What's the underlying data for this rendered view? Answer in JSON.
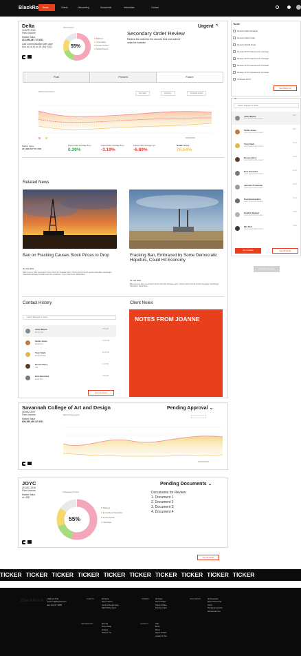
{
  "nav": {
    "logo": "BlackRock",
    "links": [
      "Home",
      "Clients",
      "Onboarding",
      "Documents",
      "Information",
      "Contact"
    ]
  },
  "delta": {
    "name": "Delta",
    "date": "12 APR 2018",
    "type": "Fixed Income",
    "market_label": "Market Value",
    "market_value": "213,998,467.72 USD",
    "last_comm": "Last Communication with Jane Doe at 14:18 on 15 JAN 2020",
    "donut_label": "55%",
    "donut_caption": "Risk Analysis",
    "legend": [
      "Balanced",
      "Conservative",
      "Growth Oriented",
      "Capital Preserve"
    ],
    "urgent": "Urgent",
    "review_title": "Secondary Order Review",
    "review_text": "Review the order for the second time and submit order for transfer",
    "tabs": [
      "Past",
      "Present",
      "Future"
    ],
    "chart_title": "Market Performance",
    "chart_filters": [
      "Sort data",
      "Currency",
      "Forecast period"
    ],
    "chart_legend": [
      "Holdings",
      "Forecast"
    ],
    "metrics": {
      "mv_label": "Market Value",
      "mv_value": "213,998,467.72 USD",
      "m1_label": "Future NAV Change 6mo",
      "m1_value": "0.39%",
      "m2_label": "Future NAV Change 6mo",
      "m2_value": "-3.19%",
      "m3_label": "Future NAV Change 1yr",
      "m3_value": "-6.89%",
      "m4_label": "Health Score",
      "m4_value": "76.54%"
    }
  },
  "news": {
    "title": "Related News",
    "items": [
      {
        "title": "Ban on Fracking Causes Stock Prices to Drop",
        "date": "30 JAN 2020",
        "body": "Bacon ipsum dolor amet beef t-bone short loin brisaola cupim, chuck ground round venison shoulder. Hamburger frankfurter kielbasa shoulder pork loin tenderloin. Cupim ham hock. Read More"
      },
      {
        "title": "Fracking Ban, Embraced by Some Democratic Hopefuls, Could Hit Economy",
        "date": "30 JAN 2020",
        "body": "Bacon ipsum dolor amet beef t-bone short loin brisaola cupim, chuck ground round venison shoulder. Hamburger frankfurter. Read More"
      }
    ]
  },
  "contact_history": {
    "title": "Contact History",
    "search_placeholder": "Search Manager or Status",
    "rows": [
      {
        "name": "John Wayne",
        "sub": "Phone Call",
        "time": "9:30 AM"
      },
      {
        "name": "Sarah Jones",
        "sub": "Email Sent",
        "time": "10:30 AM"
      },
      {
        "name": "Tony Stark",
        "sub": "Email Manager",
        "time": "11:00 AM"
      },
      {
        "name": "Bessie Berry",
        "sub": "Call",
        "time": "1:00 PM"
      },
      {
        "name": "Bob Sunshine",
        "sub": "Email Sent",
        "time": "3:00 PM"
      }
    ],
    "button": "See Full History"
  },
  "client_notes": {
    "title": "Client Notes",
    "notes_title": "NOTES FROM JOANNE"
  },
  "savannah": {
    "name": "Savannah College of Art and Design",
    "date": "26 MAY 2007",
    "type": "Fixed Income",
    "market_label": "Market Value",
    "market_value": "600,385,490.32 USD",
    "status": "Pending Approval",
    "chart_title": "Market Performance"
  },
  "joyc": {
    "name": "JOYC",
    "date": "29 DEC 2016",
    "type": "Fixed Income",
    "market_label": "Market Value",
    "market_value": "xx USD",
    "status": "Pending Documents",
    "donut_label": "55%",
    "donut_caption": "Outstanding Process",
    "legend": [
      "Balanced",
      "Income Bound Negotiation",
      "Income Spread",
      "Total Phase"
    ],
    "docs_title": "Documents for Review:",
    "docs": [
      "1. Document 1",
      "2. Document 2",
      "3. Document 3",
      "4. Document 4"
    ]
  },
  "see_all_clients": "See All Clients",
  "todo": {
    "title": "To-do",
    "items": [
      "Review Delta Situation",
      "Review Delta Order",
      "Review SCAD Order",
      "Review JOYC Document 1 Answer",
      "Review JOYC Document 2 Answer",
      "Review JOYC Document 3 Answer",
      "Review JOYC Document 4 Answer",
      "Onboard JOYC"
    ],
    "button": "See Whole List"
  },
  "managers": {
    "search_placeholder": "Search Manager or Status",
    "rows": [
      {
        "name": "John Wayne",
        "sub": "Lorem ipsum dolor sit amet",
        "time": "9:30"
      },
      {
        "name": "Sarah Jones",
        "sub": "Lorem ipsum dolor sit amet",
        "time": "9:45"
      },
      {
        "name": "Tony Stark",
        "sub": "Lorem ipsum dolor sit amet",
        "time": "10:00"
      },
      {
        "name": "Bessie Berry",
        "sub": "Lorem ipsum dolor sit amet",
        "time": "10:30"
      },
      {
        "name": "Bob Sunshine",
        "sub": "Lorem ipsum dolor sit amet",
        "time": "11:00"
      },
      {
        "name": "Jennifer Probanski",
        "sub": "Lorem ipsum dolor sit amet",
        "time": "11:30"
      },
      {
        "name": "Noel Bomberkins",
        "sub": "Lorem ipsum dolor sit amet",
        "time": "12:00"
      },
      {
        "name": "Heather Rainier",
        "sub": "Lorem ipsum dolor sit amet",
        "time": "13:00"
      },
      {
        "name": "Mat Bret",
        "sub": "Lorem ipsum dolor sit amet",
        "time": "14:00"
      }
    ],
    "btn_see": "See Available",
    "btn_all": "See All Clients",
    "btn_more": "Load More Managers"
  },
  "ticker": {
    "word": "TICKER",
    "count": 10
  },
  "footer": {
    "logo": "BlackRock",
    "contact": [
      "1-800-441-7762",
      "contact.us@blackrock.com",
      "New York, NY 10055"
    ],
    "clients_head": "CLIENTS",
    "clients": [
      "All Clients",
      "Recent Clients",
      "Clients to Review Soon",
      "High Priority Clients"
    ],
    "orders_head": "ORDERS",
    "orders": [
      "All Orders",
      "Recent Orders",
      "Orders to Place",
      "Pending Orders"
    ],
    "docs_head": "DOCUMENTS",
    "docs": [
      "All Documents",
      "Recent Documents",
      "Forms",
      "Pending Documents",
      "Documents to Go"
    ],
    "info_head": "INFORMATION",
    "info": [
      "All Links",
      "Phone Guide",
      "All News",
      "News for You"
    ],
    "contact_head": "CONTACT",
    "contact_links": [
      "Chat",
      "Email",
      "Phone",
      "Report Incident",
      "Contact Us Two"
    ]
  }
}
